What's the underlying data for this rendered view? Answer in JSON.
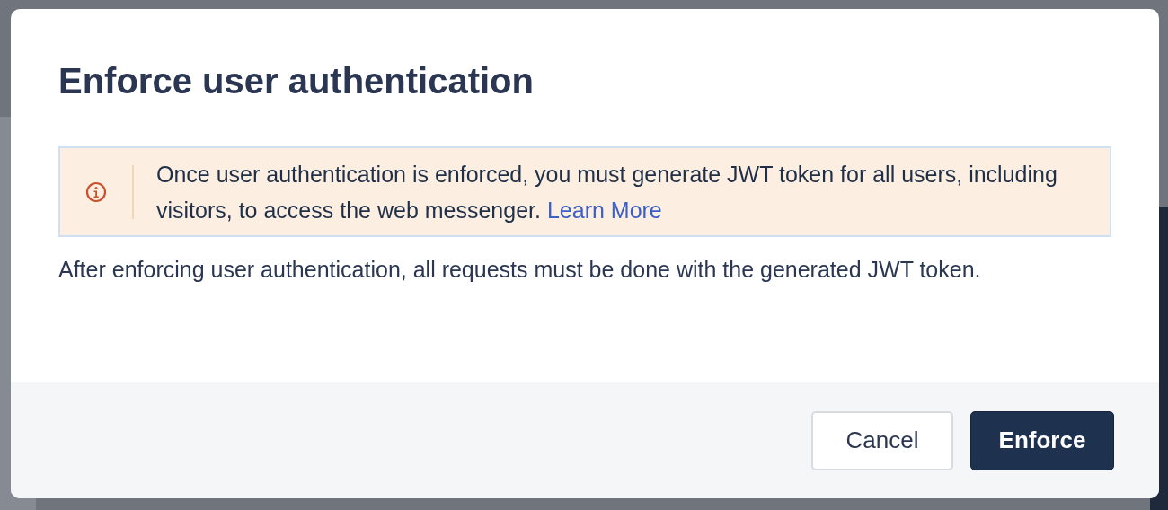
{
  "dialog": {
    "title": "Enforce user authentication",
    "alert": {
      "message": "Once user authentication is enforced, you must generate JWT token for all users, including visitors, to access the web messenger.",
      "link": "Learn More"
    },
    "body": "After enforcing user authentication, all requests must be done with the generated JWT token.",
    "buttons": [
      {
        "label": "Cancel",
        "kind": "secondary"
      },
      {
        "label": "Enforce",
        "kind": "primary"
      }
    ]
  }
}
